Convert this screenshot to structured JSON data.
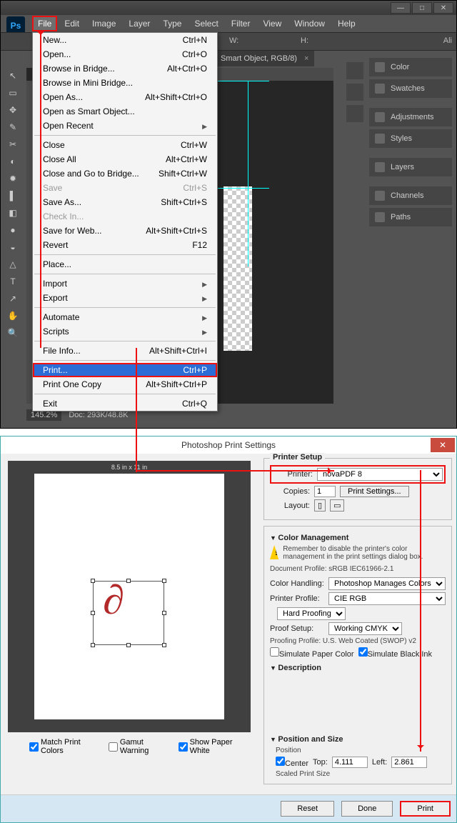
{
  "menubar": [
    "File",
    "Edit",
    "Image",
    "Layer",
    "Type",
    "Select",
    "Filter",
    "View",
    "Window",
    "Help"
  ],
  "optbar": {
    "w": "W:",
    "h": "H:",
    "all": "Ali"
  },
  "doc_tab": "Smart Object, RGB/8)",
  "status": {
    "zoom": "145.2%",
    "doc": "Doc: 293K/48.8K"
  },
  "panels": [
    "Color",
    "Swatches",
    "Adjustments",
    "Styles",
    "Layers",
    "Channels",
    "Paths"
  ],
  "file_menu": [
    {
      "l": "New...",
      "s": "Ctrl+N"
    },
    {
      "l": "Open...",
      "s": "Ctrl+O"
    },
    {
      "l": "Browse in Bridge...",
      "s": "Alt+Ctrl+O"
    },
    {
      "l": "Browse in Mini Bridge...",
      "s": ""
    },
    {
      "l": "Open As...",
      "s": "Alt+Shift+Ctrl+O"
    },
    {
      "l": "Open as Smart Object...",
      "s": ""
    },
    {
      "l": "Open Recent",
      "s": "",
      "sub": true
    },
    {
      "sep": true
    },
    {
      "l": "Close",
      "s": "Ctrl+W"
    },
    {
      "l": "Close All",
      "s": "Alt+Ctrl+W"
    },
    {
      "l": "Close and Go to Bridge...",
      "s": "Shift+Ctrl+W"
    },
    {
      "l": "Save",
      "s": "Ctrl+S",
      "dis": true
    },
    {
      "l": "Save As...",
      "s": "Shift+Ctrl+S"
    },
    {
      "l": "Check In...",
      "s": "",
      "dis": true
    },
    {
      "l": "Save for Web...",
      "s": "Alt+Shift+Ctrl+S"
    },
    {
      "l": "Revert",
      "s": "F12"
    },
    {
      "sep": true
    },
    {
      "l": "Place...",
      "s": ""
    },
    {
      "sep": true
    },
    {
      "l": "Import",
      "s": "",
      "sub": true
    },
    {
      "l": "Export",
      "s": "",
      "sub": true
    },
    {
      "sep": true
    },
    {
      "l": "Automate",
      "s": "",
      "sub": true
    },
    {
      "l": "Scripts",
      "s": "",
      "sub": true
    },
    {
      "sep": true
    },
    {
      "l": "File Info...",
      "s": "Alt+Shift+Ctrl+I"
    },
    {
      "sep": true
    },
    {
      "l": "Print...",
      "s": "Ctrl+P",
      "sel": true
    },
    {
      "l": "Print One Copy",
      "s": "Alt+Shift+Ctrl+P"
    },
    {
      "sep": true
    },
    {
      "l": "Exit",
      "s": "Ctrl+Q"
    }
  ],
  "print": {
    "title": "Photoshop Print Settings",
    "paper_dim": "8.5 in x 11 in",
    "checks": {
      "match": "Match Print Colors",
      "gamut": "Gamut Warning",
      "white": "Show Paper White"
    },
    "setup": {
      "legend": "Printer Setup",
      "printer_lbl": "Printer:",
      "printer_val": "novaPDF 8",
      "copies_lbl": "Copies:",
      "copies_val": "1",
      "settings_btn": "Print Settings...",
      "layout_lbl": "Layout:"
    },
    "cm": {
      "legend": "Color Management",
      "warn": "Remember to disable the printer's color management in the print settings dialog box.",
      "docprof_lbl": "Document Profile:",
      "docprof_val": "sRGB IEC61966-2.1",
      "handling_lbl": "Color Handling:",
      "handling_val": "Photoshop Manages Colors",
      "pprof_lbl": "Printer Profile:",
      "pprof_val": "CIE RGB",
      "hard_proof": "Hard Proofing",
      "proof_lbl": "Proof Setup:",
      "proof_val": "Working CMYK",
      "proofing_profile": "Proofing Profile: U.S. Web Coated (SWOP) v2",
      "sim_paper": "Simulate Paper Color",
      "sim_black": "Simulate Black Ink"
    },
    "desc_legend": "Description",
    "pos": {
      "legend": "Position and Size",
      "position": "Position",
      "center": "Center",
      "top_lbl": "Top:",
      "top_val": "4.111",
      "left_lbl": "Left:",
      "left_val": "2.861",
      "scaled": "Scaled Print Size"
    },
    "buttons": {
      "reset": "Reset",
      "done": "Done",
      "print": "Print"
    }
  }
}
